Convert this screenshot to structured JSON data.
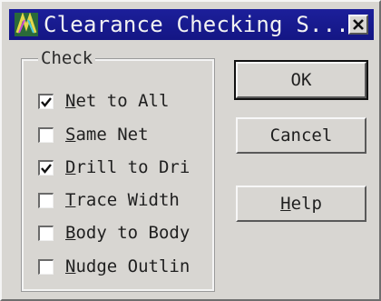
{
  "window": {
    "title": "Clearance Checking S...",
    "icon": "app-logo-icon",
    "close_icon": "close-icon"
  },
  "check_group": {
    "label": "Check",
    "items": [
      {
        "pre": "",
        "mnemonic": "N",
        "post": "et to All",
        "checked": true
      },
      {
        "pre": "",
        "mnemonic": "S",
        "post": "ame Net",
        "checked": false
      },
      {
        "pre": "",
        "mnemonic": "D",
        "post": "rill to Dri",
        "checked": true
      },
      {
        "pre": "",
        "mnemonic": "T",
        "post": "race Width",
        "checked": false
      },
      {
        "pre": "",
        "mnemonic": "B",
        "post": "ody to Body",
        "checked": false
      },
      {
        "pre": "",
        "mnemonic": "N",
        "post": "udge Outlin",
        "checked": false
      }
    ]
  },
  "buttons": {
    "ok": "OK",
    "cancel": "Cancel",
    "help_mnemonic": "H",
    "help_rest": "elp"
  },
  "colors": {
    "titlebar": "#141684",
    "dialog_bg": "#d8d6d2",
    "title_text": "#f2f2f2"
  }
}
